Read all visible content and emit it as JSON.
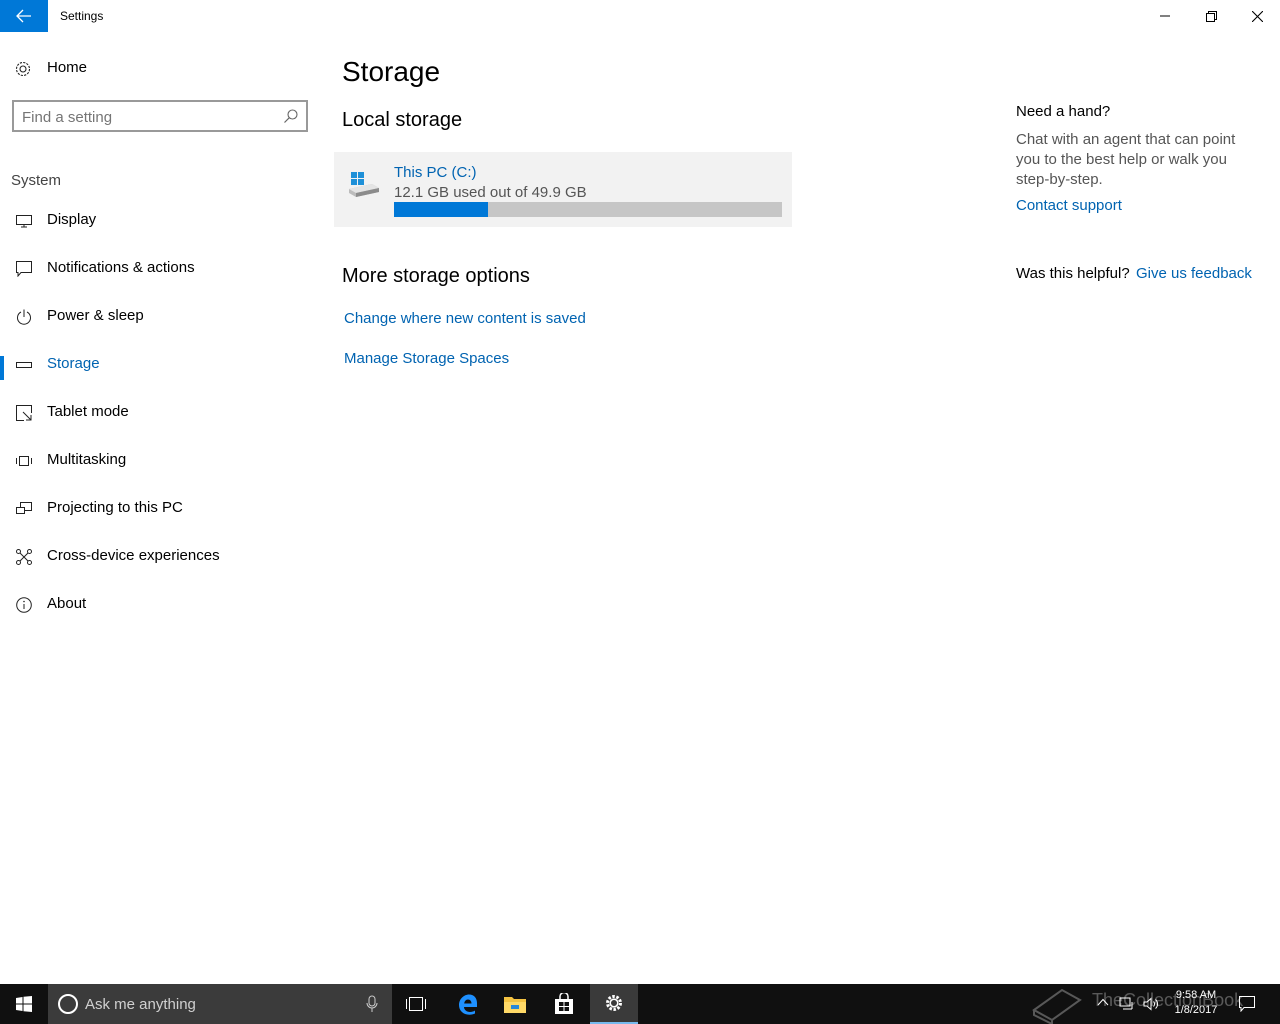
{
  "window": {
    "title": "Settings"
  },
  "sidebar": {
    "home_label": "Home",
    "search_placeholder": "Find a setting",
    "section": "System",
    "items": [
      {
        "label": "Display",
        "icon": "display-icon"
      },
      {
        "label": "Notifications & actions",
        "icon": "notifications-icon"
      },
      {
        "label": "Power & sleep",
        "icon": "power-icon"
      },
      {
        "label": "Storage",
        "icon": "storage-icon",
        "active": true
      },
      {
        "label": "Tablet mode",
        "icon": "tablet-mode-icon"
      },
      {
        "label": "Multitasking",
        "icon": "multitasking-icon"
      },
      {
        "label": "Projecting to this PC",
        "icon": "projecting-icon"
      },
      {
        "label": "Cross-device experiences",
        "icon": "cross-device-icon"
      },
      {
        "label": "About",
        "icon": "info-icon"
      }
    ]
  },
  "main": {
    "title": "Storage",
    "local_storage_heading": "Local storage",
    "drive": {
      "name": "This PC (C:)",
      "usage_text": "12.1 GB used out of 49.9 GB",
      "used_fraction": 0.2425
    },
    "more_options_heading": "More storage options",
    "links": [
      "Change where new content is saved",
      "Manage Storage Spaces"
    ]
  },
  "help": {
    "heading": "Need a hand?",
    "body": "Chat with an agent that can point you to the best help or walk you step-by-step.",
    "contact_link": "Contact support",
    "helpful_question": "Was this helpful?",
    "feedback_link": "Give us feedback"
  },
  "taskbar": {
    "search_placeholder": "Ask me anything",
    "time": "9:58 AM",
    "date": "1/8/2017",
    "watermark": "TheCollectionBook"
  },
  "colors": {
    "accent": "#0078d7",
    "link": "#0063b1",
    "taskbar": "#101010"
  }
}
